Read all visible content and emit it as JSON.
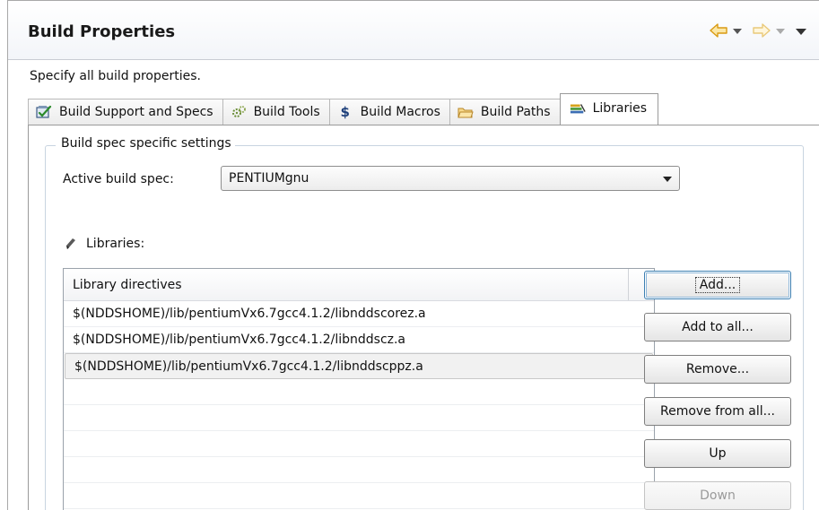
{
  "header": {
    "title": "Build Properties"
  },
  "description": "Specify all build properties.",
  "tabs": [
    {
      "label": "Build Support and Specs",
      "icon": "build-support-icon",
      "active": false
    },
    {
      "label": "Build Tools",
      "icon": "build-tools-icon",
      "active": false
    },
    {
      "label": "Build Macros",
      "icon": "dollar-icon",
      "active": false
    },
    {
      "label": "Build Paths",
      "icon": "folder-icon",
      "active": false
    },
    {
      "label": "Libraries",
      "icon": "libraries-icon",
      "active": true
    }
  ],
  "group": {
    "legend": "Build spec specific settings",
    "active_spec_label": "Active build spec:",
    "active_spec_value": "PENTIUMgnu"
  },
  "libraries": {
    "label": "Libraries:",
    "column_header": "Library directives",
    "rows": [
      "$(NDDSHOME)/lib/pentiumVx6.7gcc4.1.2/libnddscorez.a",
      "$(NDDSHOME)/lib/pentiumVx6.7gcc4.1.2/libnddscz.a",
      "$(NDDSHOME)/lib/pentiumVx6.7gcc4.1.2/libnddscppz.a"
    ],
    "selected_row": 2
  },
  "buttons": {
    "add": "Add...",
    "add_to_all": "Add to all...",
    "remove": "Remove...",
    "remove_from_all": "Remove from all...",
    "up": "Up",
    "down": "Down"
  },
  "colors": {
    "nav_back_arrow": "#e8a317",
    "nav_forward_arrow": "#f2d98a"
  }
}
